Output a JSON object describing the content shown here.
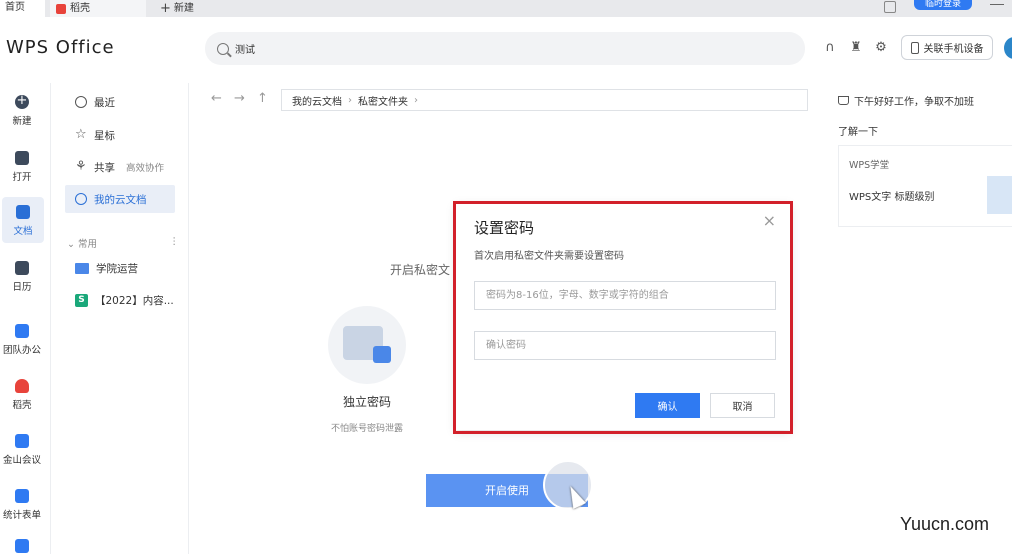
{
  "tabs": {
    "home": "首页",
    "doc": "稻壳",
    "new": "新建"
  },
  "top": {
    "login": "临时登录"
  },
  "header": {
    "brand": "WPS Office",
    "search_value": "测试",
    "phone_button": "关联手机设备"
  },
  "rail": [
    {
      "label": "新建",
      "icon": "plus-circle-icon"
    },
    {
      "label": "打开",
      "icon": "folder-open-icon"
    },
    {
      "label": "文档",
      "icon": "document-icon"
    },
    {
      "label": "日历",
      "icon": "calendar-icon"
    },
    {
      "label": "团队办公",
      "icon": "team-icon"
    },
    {
      "label": "稻壳",
      "icon": "docer-icon"
    },
    {
      "label": "金山会议",
      "icon": "meeting-icon"
    },
    {
      "label": "统计表单",
      "icon": "form-icon"
    }
  ],
  "nav": {
    "recent": "最近",
    "starred": "星标",
    "shared": "共享",
    "shared_sub": "高效协作",
    "cloud": "我的云文档",
    "section": "常用",
    "items": [
      "学院运营",
      "【2022】内容..."
    ]
  },
  "breadcrumb": {
    "root": "我的云文档",
    "current": "私密文件夹"
  },
  "intro": {
    "title": "开启私密文",
    "feature_title": "独立密码",
    "feature_desc": "不怕账号密码泄露",
    "enable_button": "开启使用"
  },
  "right": {
    "greeting": "下午好好工作，争取不加班",
    "learn": "了解一下",
    "card_title": "WPS学堂",
    "card_item": "WPS文字 标题级别"
  },
  "dialog": {
    "title": "设置密码",
    "subtitle": "首次启用私密文件夹需要设置密码",
    "password_placeholder": "密码为8-16位，字母、数字或字符的组合",
    "confirm_placeholder": "确认密码",
    "ok": "确认",
    "cancel": "取消",
    "close": "×"
  },
  "watermark": "Yuucn.com",
  "colors": {
    "accent": "#2f7af2",
    "highlight_border": "#d2202a"
  }
}
